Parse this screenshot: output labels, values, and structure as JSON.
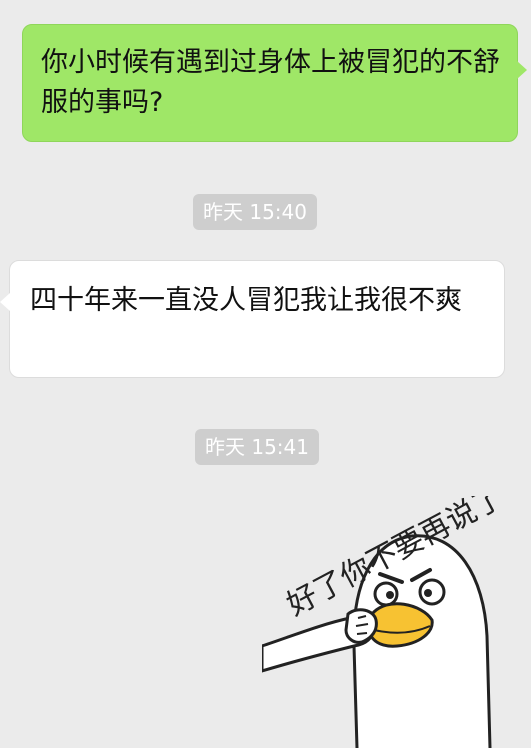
{
  "chat": {
    "messages": [
      {
        "side": "outgoing",
        "text": "你小时候有遇到过身体上被冒犯的不舒服的事吗?"
      },
      {
        "side": "incoming",
        "text": "四十年来一直没人冒犯我让我很不爽"
      }
    ],
    "timestamps": [
      "昨天 15:40",
      "昨天 15:41"
    ],
    "sticker": {
      "caption": "好了你不要再说了"
    }
  },
  "colors": {
    "background": "#ebebeb",
    "outgoing_bubble": "#9fe767",
    "incoming_bubble": "#ffffff",
    "timestamp_pill": "#cecece",
    "duck_beak": "#f7c232"
  }
}
